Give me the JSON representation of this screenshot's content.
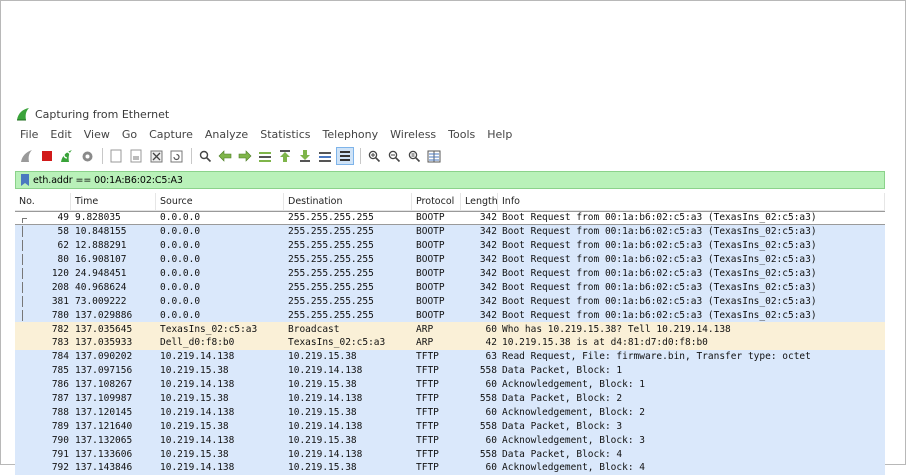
{
  "window": {
    "title": "Capturing from Ethernet"
  },
  "menu": [
    "File",
    "Edit",
    "View",
    "Go",
    "Capture",
    "Analyze",
    "Statistics",
    "Telephony",
    "Wireless",
    "Tools",
    "Help"
  ],
  "toolbar": {
    "buttons": [
      "shark-fin-start-icon",
      "stop-icon",
      "restart-icon",
      "options-gear-icon",
      "open-file-icon",
      "save-file-icon",
      "close-file-icon",
      "reload-icon",
      "find-icon",
      "back-arrow-icon",
      "forward-arrow-icon",
      "go-to-packet-icon",
      "first-packet-icon",
      "last-packet-icon",
      "auto-scroll-icon",
      "colorize-icon",
      "zoom-in-icon",
      "zoom-out-icon",
      "normal-size-icon",
      "resize-columns-icon"
    ]
  },
  "filter": {
    "value": "eth.addr == 00:1A:B6:02:C5:A3"
  },
  "columns": {
    "no": "No.",
    "time": "Time",
    "source": "Source",
    "destination": "Destination",
    "protocol": "Protocol",
    "length": "Length",
    "info": "Info"
  },
  "packets": [
    {
      "no": "49",
      "time": "9.828035",
      "src": "0.0.0.0",
      "dst": "255.255.255.255",
      "proto": "BOOTP",
      "len": "342",
      "info": "Boot Request from 00:1a:b6:02:c5:a3 (TexasIns_02:c5:a3)"
    },
    {
      "no": "58",
      "time": "10.848155",
      "src": "0.0.0.0",
      "dst": "255.255.255.255",
      "proto": "BOOTP",
      "len": "342",
      "info": "Boot Request from 00:1a:b6:02:c5:a3 (TexasIns_02:c5:a3)"
    },
    {
      "no": "62",
      "time": "12.888291",
      "src": "0.0.0.0",
      "dst": "255.255.255.255",
      "proto": "BOOTP",
      "len": "342",
      "info": "Boot Request from 00:1a:b6:02:c5:a3 (TexasIns_02:c5:a3)"
    },
    {
      "no": "80",
      "time": "16.908107",
      "src": "0.0.0.0",
      "dst": "255.255.255.255",
      "proto": "BOOTP",
      "len": "342",
      "info": "Boot Request from 00:1a:b6:02:c5:a3 (TexasIns_02:c5:a3)"
    },
    {
      "no": "120",
      "time": "24.948451",
      "src": "0.0.0.0",
      "dst": "255.255.255.255",
      "proto": "BOOTP",
      "len": "342",
      "info": "Boot Request from 00:1a:b6:02:c5:a3 (TexasIns_02:c5:a3)"
    },
    {
      "no": "208",
      "time": "40.968624",
      "src": "0.0.0.0",
      "dst": "255.255.255.255",
      "proto": "BOOTP",
      "len": "342",
      "info": "Boot Request from 00:1a:b6:02:c5:a3 (TexasIns_02:c5:a3)"
    },
    {
      "no": "381",
      "time": "73.009222",
      "src": "0.0.0.0",
      "dst": "255.255.255.255",
      "proto": "BOOTP",
      "len": "342",
      "info": "Boot Request from 00:1a:b6:02:c5:a3 (TexasIns_02:c5:a3)"
    },
    {
      "no": "780",
      "time": "137.029886",
      "src": "0.0.0.0",
      "dst": "255.255.255.255",
      "proto": "BOOTP",
      "len": "342",
      "info": "Boot Request from 00:1a:b6:02:c5:a3 (TexasIns_02:c5:a3)"
    },
    {
      "no": "782",
      "time": "137.035645",
      "src": "TexasIns_02:c5:a3",
      "dst": "Broadcast",
      "proto": "ARP",
      "len": "60",
      "info": "Who has 10.219.15.38? Tell 10.219.14.138"
    },
    {
      "no": "783",
      "time": "137.035933",
      "src": "Dell_d0:f8:b0",
      "dst": "TexasIns_02:c5:a3",
      "proto": "ARP",
      "len": "42",
      "info": "10.219.15.38 is at d4:81:d7:d0:f8:b0"
    },
    {
      "no": "784",
      "time": "137.090202",
      "src": "10.219.14.138",
      "dst": "10.219.15.38",
      "proto": "TFTP",
      "len": "63",
      "info": "Read Request, File: firmware.bin, Transfer type: octet"
    },
    {
      "no": "785",
      "time": "137.097156",
      "src": "10.219.15.38",
      "dst": "10.219.14.138",
      "proto": "TFTP",
      "len": "558",
      "info": "Data Packet, Block: 1"
    },
    {
      "no": "786",
      "time": "137.108267",
      "src": "10.219.14.138",
      "dst": "10.219.15.38",
      "proto": "TFTP",
      "len": "60",
      "info": "Acknowledgement, Block: 1"
    },
    {
      "no": "787",
      "time": "137.109987",
      "src": "10.219.15.38",
      "dst": "10.219.14.138",
      "proto": "TFTP",
      "len": "558",
      "info": "Data Packet, Block: 2"
    },
    {
      "no": "788",
      "time": "137.120145",
      "src": "10.219.14.138",
      "dst": "10.219.15.38",
      "proto": "TFTP",
      "len": "60",
      "info": "Acknowledgement, Block: 2"
    },
    {
      "no": "789",
      "time": "137.121640",
      "src": "10.219.15.38",
      "dst": "10.219.14.138",
      "proto": "TFTP",
      "len": "558",
      "info": "Data Packet, Block: 3"
    },
    {
      "no": "790",
      "time": "137.132065",
      "src": "10.219.14.138",
      "dst": "10.219.15.38",
      "proto": "TFTP",
      "len": "60",
      "info": "Acknowledgement, Block: 3"
    },
    {
      "no": "791",
      "time": "137.133606",
      "src": "10.219.15.38",
      "dst": "10.219.14.138",
      "proto": "TFTP",
      "len": "558",
      "info": "Data Packet, Block: 4"
    },
    {
      "no": "792",
      "time": "137.143846",
      "src": "10.219.14.138",
      "dst": "10.219.15.38",
      "proto": "TFTP",
      "len": "60",
      "info": "Acknowledgement, Block: 4"
    }
  ],
  "colors": {
    "bootp_tftp_row": "#dae8fb",
    "arp_row": "#faf0d7",
    "filter_valid": "#b9f1b9"
  }
}
